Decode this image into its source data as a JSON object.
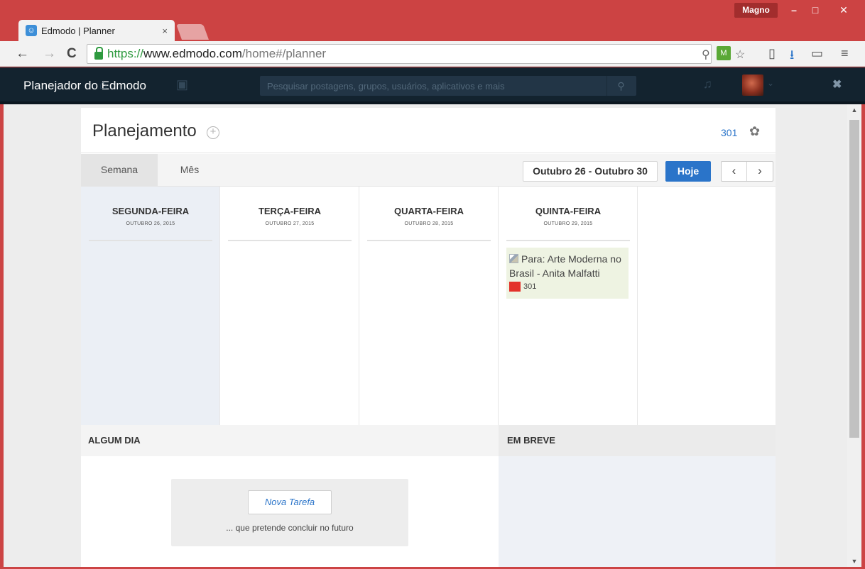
{
  "window": {
    "user": "Magno",
    "minimize": "–",
    "maximize": "□",
    "close": "✕"
  },
  "tab": {
    "favicon": "☺",
    "title": "Edmodo | Planner",
    "close": "×"
  },
  "toolbar": {
    "back": "←",
    "forward": "→",
    "reload": "C",
    "url_scheme": "https://",
    "url_host": "www.edmodo.com",
    "url_path": "/home#/planner",
    "zoom_icon": "⚲",
    "ext_badge": "M",
    "star_icon": "☆",
    "reader_icon": "▯",
    "download_icon": "⭳",
    "cast_icon": "▭",
    "menu_icon": "≡"
  },
  "app": {
    "title": "Planejador do Edmodo",
    "home_icon": "⌂",
    "calendar_icon": "▣",
    "search_placeholder": "Pesquisar postagens, grupos, usuários, aplicativos e mais",
    "search_icon": "⚲",
    "bell_icon": "♫",
    "caret": "⌄",
    "close": "✖"
  },
  "planner": {
    "title": "Planejamento",
    "add": "+",
    "group_link": "301",
    "settings_icon": "✿",
    "tabs": [
      {
        "label": "Semana"
      },
      {
        "label": "Mês"
      }
    ],
    "range": "Outubro 26 - Outubro 30",
    "today": "Hoje",
    "prev": "‹",
    "next": "›",
    "days": [
      {
        "name": "SEGUNDA-FEIRA",
        "date": "OUTUBRO 26, 2015"
      },
      {
        "name": "TERÇA-FEIRA",
        "date": "OUTUBRO 27, 2015"
      },
      {
        "name": "QUARTA-FEIRA",
        "date": "OUTUBRO 28, 2015"
      },
      {
        "name": "QUINTA-FEIRA",
        "date": "OUTUBRO 29, 2015"
      },
      {
        "name": "",
        "date": ""
      }
    ],
    "task": {
      "text": "Para: Arte Moderna no Brasil - Anita Malfatti",
      "group": "301",
      "group_color": "#e3312a"
    },
    "someday": {
      "header": "ALGUM DIA",
      "new_task": "Nova Tarefa",
      "hint": "... que pretende concluir no futuro"
    },
    "soon": {
      "header": "EM BREVE"
    }
  },
  "scroll": {
    "up": "▲",
    "down": "▼"
  },
  "colors": {
    "accent": "#2a74c9",
    "chrome": "#cc4343",
    "appbar": "#13232f"
  }
}
